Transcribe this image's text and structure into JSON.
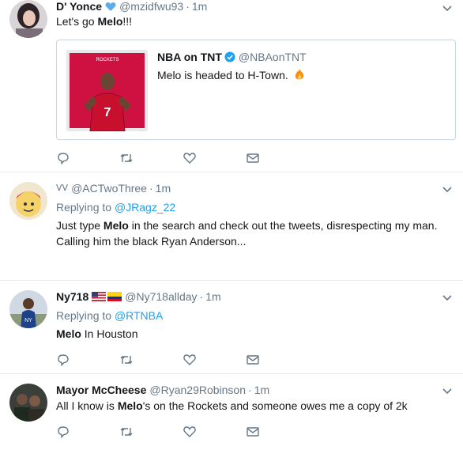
{
  "tweets": [
    {
      "name": "D' Yonce",
      "handle": "@mzidfwu93",
      "time": "1m",
      "text_pre": "Let's go ",
      "text_bold": "Melo",
      "text_post": "!!!",
      "quote": {
        "name": "NBA on TNT",
        "handle": "@NBAonTNT",
        "text": "Melo is headed to H-Town.",
        "image_caption": "ROCKETS",
        "jersey_number": "7"
      }
    },
    {
      "name_glyphs": "ᐯᐯ",
      "handle": "@ACTwoThree",
      "time": "1m",
      "replying_label": "Replying to",
      "replying_to": "@JRagz_22",
      "line1_pre": "Just type ",
      "line1_bold": "Melo",
      "line1_post": " in the search and check out the tweets, disrespecting my man.",
      "line2": "Calling him the black Ryan Anderson..."
    },
    {
      "name": "Ny718",
      "handle": "@Ny718allday",
      "time": "1m",
      "replying_label": "Replying to",
      "replying_to": "@RTNBA",
      "text_bold": "Melo",
      "text_post": " In Houston"
    },
    {
      "name": "Mayor McCheese",
      "handle": "@Ryan29Robinson",
      "time": "1m",
      "text_pre": "All I know is ",
      "text_bold": "Melo",
      "text_post": "'s on the Rockets and someone owes me a copy of 2k"
    }
  ],
  "dot": "·",
  "colors": {
    "accent": "#1da1f2",
    "muted": "#657786",
    "verified": "#1da1f2",
    "rockets_red": "#ce1141"
  }
}
